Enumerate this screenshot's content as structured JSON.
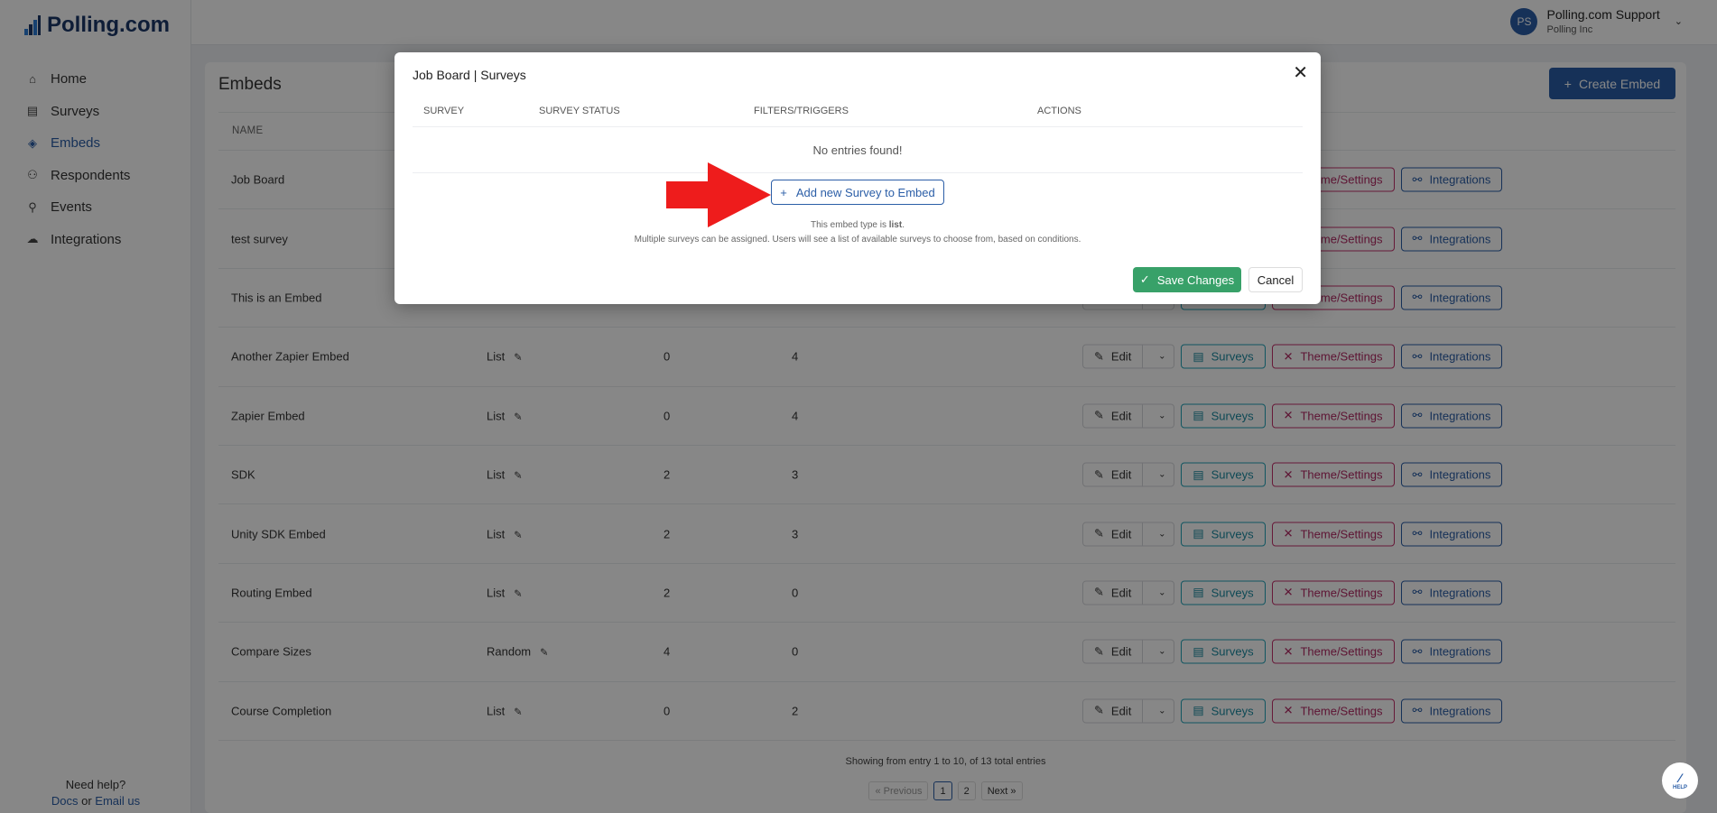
{
  "brand": {
    "name": "Polling.com"
  },
  "sidebar": {
    "items": [
      {
        "label": "Home",
        "icon": "home-icon",
        "glyph": "⌂"
      },
      {
        "label": "Surveys",
        "icon": "survey-chart-icon",
        "glyph": "▤"
      },
      {
        "label": "Embeds",
        "icon": "layers-icon",
        "glyph": "◈",
        "active": true
      },
      {
        "label": "Respondents",
        "icon": "users-icon",
        "glyph": "⚇"
      },
      {
        "label": "Events",
        "icon": "event-person-icon",
        "glyph": "⚲"
      },
      {
        "label": "Integrations",
        "icon": "cloud-network-icon",
        "glyph": "☁"
      }
    ],
    "help": {
      "question": "Need help?",
      "docs": "Docs",
      "or": " or ",
      "email": "Email us"
    }
  },
  "user": {
    "initials": "PS",
    "name": "Polling.com Support",
    "org": "Polling Inc"
  },
  "page": {
    "title": "Embeds",
    "create_label": "Create Embed",
    "name_header": "NAME"
  },
  "rows": [
    {
      "name": "Job Board",
      "type": "",
      "c3": "",
      "c4": ""
    },
    {
      "name": "test survey",
      "type": "",
      "c3": "",
      "c4": ""
    },
    {
      "name": "This is an Embed",
      "type": "",
      "c3": "",
      "c4": ""
    },
    {
      "name": "Another Zapier Embed",
      "type": "List",
      "c3": "0",
      "c4": "4"
    },
    {
      "name": "Zapier Embed",
      "type": "List",
      "c3": "0",
      "c4": "4"
    },
    {
      "name": "SDK",
      "type": "List",
      "c3": "2",
      "c4": "3"
    },
    {
      "name": "Unity SDK Embed",
      "type": "List",
      "c3": "2",
      "c4": "3"
    },
    {
      "name": "Routing Embed",
      "type": "List",
      "c3": "2",
      "c4": "0"
    },
    {
      "name": "Compare Sizes",
      "type": "Random",
      "c3": "4",
      "c4": "0"
    },
    {
      "name": "Course Completion",
      "type": "List",
      "c3": "0",
      "c4": "2"
    }
  ],
  "actions": {
    "edit": "Edit",
    "surveys": "Surveys",
    "theme": "Theme/Settings",
    "integrations": "Integrations"
  },
  "footer": {
    "showing": "Showing from entry 1 to 10, of 13 total entries",
    "prev": "« Previous",
    "pages": [
      "1",
      "2"
    ],
    "next": "Next »",
    "current_page": "1"
  },
  "help_button": {
    "label": "HELP"
  },
  "modal": {
    "title": "Job Board | Surveys",
    "columns": [
      "SURVEY",
      "SURVEY STATUS",
      "FILTERS/TRIGGERS",
      "ACTIONS"
    ],
    "empty": "No entries found!",
    "add_label": "Add new Survey to Embed",
    "type_prefix": "This embed type is ",
    "type_value": "list",
    "type_suffix": ".",
    "note": "Multiple surveys can be assigned. Users will see a list of available surveys to choose from, based on conditions.",
    "save_label": "Save Changes",
    "cancel_label": "Cancel"
  },
  "colors": {
    "brand": "#2b5ea7",
    "surveys": "#20a2b8",
    "theme": "#c2306a",
    "save": "#38a169",
    "arrow": "#ee1c1c"
  }
}
